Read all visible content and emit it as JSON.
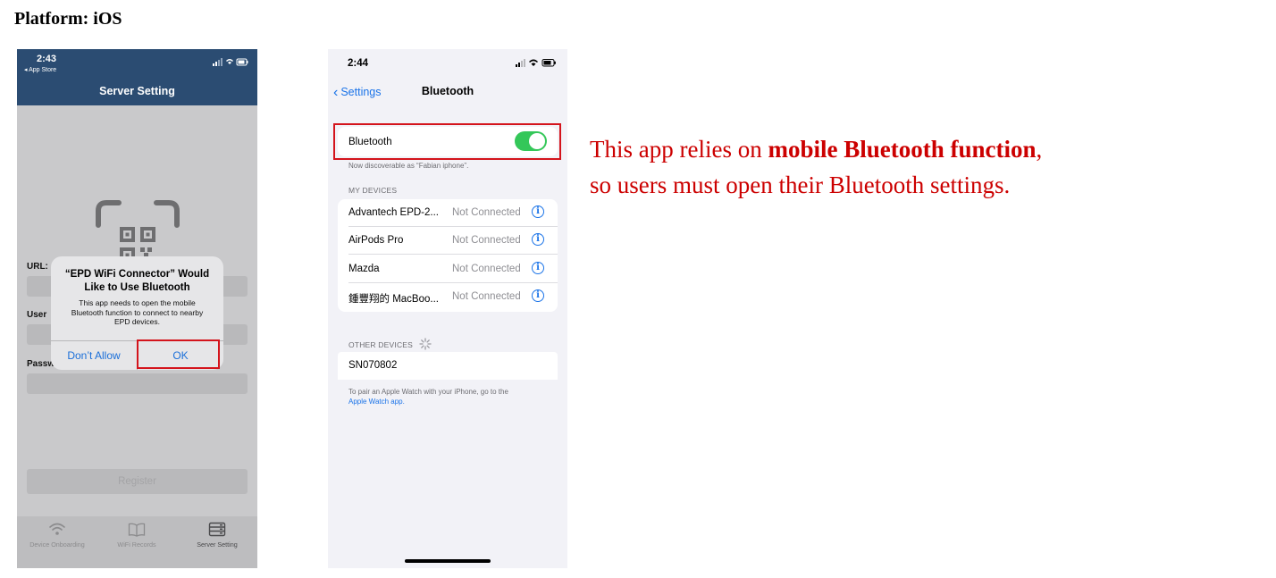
{
  "platform_label": "Platform: iOS",
  "phone1": {
    "time": "2:43",
    "back_label": "◂ App Store",
    "status_icons": "signal wifi battery",
    "title": "Server Setting",
    "scan_icon": "qr-scan-icon",
    "fields": {
      "url_label": "URL:",
      "user_label": "User",
      "password_label": "Passw"
    },
    "register_label": "Register",
    "dialog": {
      "title": "“EPD WiFi Connector” Would Like to Use Bluetooth",
      "message": "This app needs to open the mobile Bluetooth function to connect to nearby EPD devices.",
      "deny_label": "Don’t Allow",
      "ok_label": "OK"
    },
    "tabs": [
      {
        "label": "Device Onboarding",
        "icon": "wifi-icon"
      },
      {
        "label": "WiFi Records",
        "icon": "book-icon"
      },
      {
        "label": "Server Setting",
        "icon": "server-icon",
        "active": true
      }
    ]
  },
  "phone2": {
    "time": "2:44",
    "back_label": "Settings",
    "title": "Bluetooth",
    "bluetooth_label": "Bluetooth",
    "bluetooth_on": true,
    "discoverable_note": "Now discoverable as “Fabian iphone”.",
    "my_devices_header": "MY DEVICES",
    "my_devices": [
      {
        "name": "Advantech EPD-2...",
        "status": "Not Connected"
      },
      {
        "name": "AirPods Pro",
        "status": "Not Connected"
      },
      {
        "name": "Mazda",
        "status": "Not Connected"
      },
      {
        "name": "鍾豐翔的 MacBoo...",
        "status": "Not Connected"
      }
    ],
    "other_devices_header": "OTHER DEVICES",
    "other_devices": [
      {
        "name": "SN070802"
      }
    ],
    "pair_text": "To pair an Apple Watch with your iPhone, go to the",
    "pair_link": "Apple Watch app."
  },
  "caption": {
    "part1": "This app relies on ",
    "bold1": "mobile Bluetooth function",
    "part2": ", so users must open their Bluetooth settings."
  },
  "colors": {
    "highlight": "#d4141c",
    "caption": "#cc0000",
    "ios_blue": "#1a73e8",
    "toggle_green": "#34c759",
    "header_navy": "#2b4c72"
  }
}
